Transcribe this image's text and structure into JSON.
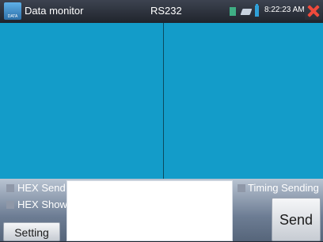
{
  "titlebar": {
    "app_icon_label": "DATA",
    "title": "Data monitor",
    "mode": "RS232",
    "time": "8:22:23 AM"
  },
  "options": {
    "hex_send": {
      "label": "HEX Send",
      "checked": false
    },
    "hex_show": {
      "label": "HEX Show",
      "checked": false
    },
    "timing_sending": {
      "label": "Timing Sending",
      "checked": false
    }
  },
  "input": {
    "value": ""
  },
  "buttons": {
    "setting": "Setting",
    "send": "Send"
  },
  "colors": {
    "pane": "#139cc9",
    "close": "#ef4a3c"
  }
}
